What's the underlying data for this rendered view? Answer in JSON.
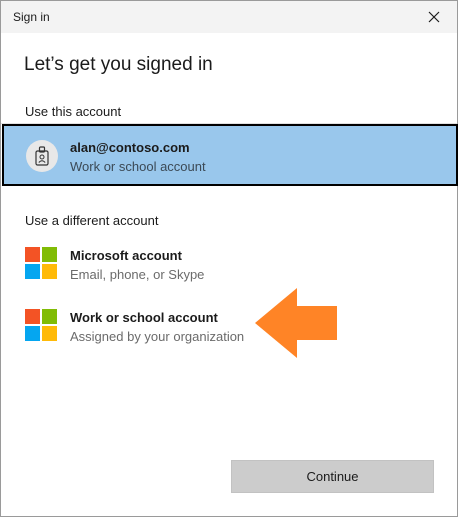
{
  "window": {
    "title": "Sign in"
  },
  "header": {
    "heading": "Let’s get you signed in"
  },
  "sections": {
    "current_label": "Use this account",
    "different_label": "Use a different account"
  },
  "current_account": {
    "email": "alan@contoso.com",
    "type": "Work or school account",
    "icon": "badge-icon"
  },
  "options": [
    {
      "name": "Microsoft account",
      "sub": "Email, phone, or Skype",
      "icon": "microsoft-logo-icon"
    },
    {
      "name": "Work or school account",
      "sub": "Assigned by your organization",
      "icon": "microsoft-logo-icon"
    }
  ],
  "footer": {
    "continue_label": "Continue"
  },
  "colors": {
    "selected_bg": "#99c7ec",
    "arrow": "#ff8426",
    "ms_red": "#f35325",
    "ms_green": "#81bc06",
    "ms_blue": "#05a6f0",
    "ms_yellow": "#ffba08"
  }
}
